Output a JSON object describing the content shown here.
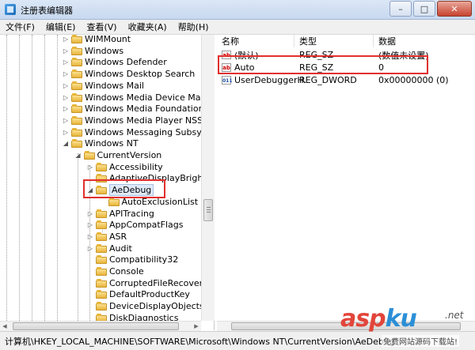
{
  "window": {
    "title": "注册表编辑器"
  },
  "menu": [
    "文件(F)",
    "编辑(E)",
    "查看(V)",
    "收藏夹(A)",
    "帮助(H)"
  ],
  "tree": {
    "items": [
      {
        "label": "WIMMount",
        "depth": 0,
        "expander": "closed"
      },
      {
        "label": "Windows",
        "depth": 0,
        "expander": "closed"
      },
      {
        "label": "Windows Defender",
        "depth": 0,
        "expander": "closed"
      },
      {
        "label": "Windows Desktop Search",
        "depth": 0,
        "expander": "closed"
      },
      {
        "label": "Windows Mail",
        "depth": 0,
        "expander": "closed"
      },
      {
        "label": "Windows Media Device Manager",
        "depth": 0,
        "expander": "closed"
      },
      {
        "label": "Windows Media Foundation",
        "depth": 0,
        "expander": "closed"
      },
      {
        "label": "Windows Media Player NSS",
        "depth": 0,
        "expander": "closed"
      },
      {
        "label": "Windows Messaging Subsystem",
        "depth": 0,
        "expander": "closed"
      },
      {
        "label": "Windows NT",
        "depth": 0,
        "expander": "open"
      },
      {
        "label": "CurrentVersion",
        "depth": 1,
        "expander": "open"
      },
      {
        "label": "Accessibility",
        "depth": 2,
        "expander": "closed"
      },
      {
        "label": "AdaptiveDisplayBrightness",
        "depth": 2,
        "expander": "none"
      },
      {
        "label": "AeDebug",
        "depth": 2,
        "expander": "open",
        "selected": true
      },
      {
        "label": "AutoExclusionList",
        "depth": 3,
        "expander": "none"
      },
      {
        "label": "APITracing",
        "depth": 2,
        "expander": "closed"
      },
      {
        "label": "AppCompatFlags",
        "depth": 2,
        "expander": "closed"
      },
      {
        "label": "ASR",
        "depth": 2,
        "expander": "closed"
      },
      {
        "label": "Audit",
        "depth": 2,
        "expander": "closed"
      },
      {
        "label": "Compatibility32",
        "depth": 2,
        "expander": "none"
      },
      {
        "label": "Console",
        "depth": 2,
        "expander": "none"
      },
      {
        "label": "CorruptedFileRecovery",
        "depth": 2,
        "expander": "none"
      },
      {
        "label": "DefaultProductKey",
        "depth": 2,
        "expander": "none"
      },
      {
        "label": "DeviceDisplayObjects",
        "depth": 2,
        "expander": "none"
      },
      {
        "label": "DiskDiagnostics",
        "depth": 2,
        "expander": "none"
      }
    ]
  },
  "values": {
    "columns": [
      "名称",
      "类型",
      "数据"
    ],
    "rows": [
      {
        "name": "(默认)",
        "type": "REG_SZ",
        "data": "(数值未设置)",
        "icon": "string-value-icon"
      },
      {
        "name": "Auto",
        "type": "REG_SZ",
        "data": "0",
        "icon": "string-value-icon"
      },
      {
        "name": "UserDebuggerH...",
        "type": "REG_DWORD",
        "data": "0x00000000 (0)",
        "icon": "dword-value-icon"
      }
    ]
  },
  "status": {
    "path": "计算机\\HKEY_LOCAL_MACHINE\\SOFTWARE\\Microsoft\\Windows NT\\CurrentVersion\\AeDebug"
  },
  "watermark": {
    "brand_a": "asp",
    "brand_b": "ku",
    "suffix": ".net",
    "subtitle": "免费网站源码下载站!"
  },
  "colors": {
    "annotation": "#e0302e",
    "brand_red": "#e2453a",
    "brand_blue": "#2b8fd6"
  }
}
